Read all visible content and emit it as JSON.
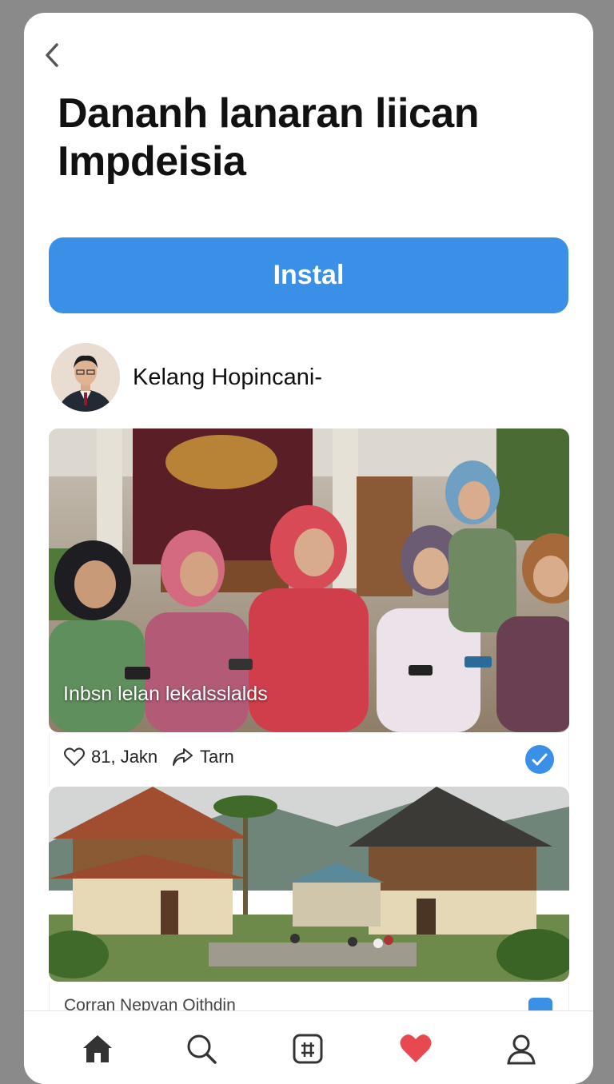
{
  "header": {
    "title": "Dananh lanaran liican Impdeisia"
  },
  "install_button": {
    "label": "Instal"
  },
  "author": {
    "name": "Kelang Hopincani-"
  },
  "post": {
    "caption": "Inbsn lelan lekalsslalds",
    "likes": "81, Jakn",
    "share_label": "Tarn"
  },
  "post2": {
    "caption": "Corran Nepvan Oithdin"
  },
  "tabbar": {
    "items": [
      "home-icon",
      "search-icon",
      "grid-icon",
      "heart-icon",
      "profile-icon"
    ]
  },
  "colors": {
    "accent": "#3a8fe6",
    "heart": "#e8484f",
    "background": "#8a8a8a"
  }
}
